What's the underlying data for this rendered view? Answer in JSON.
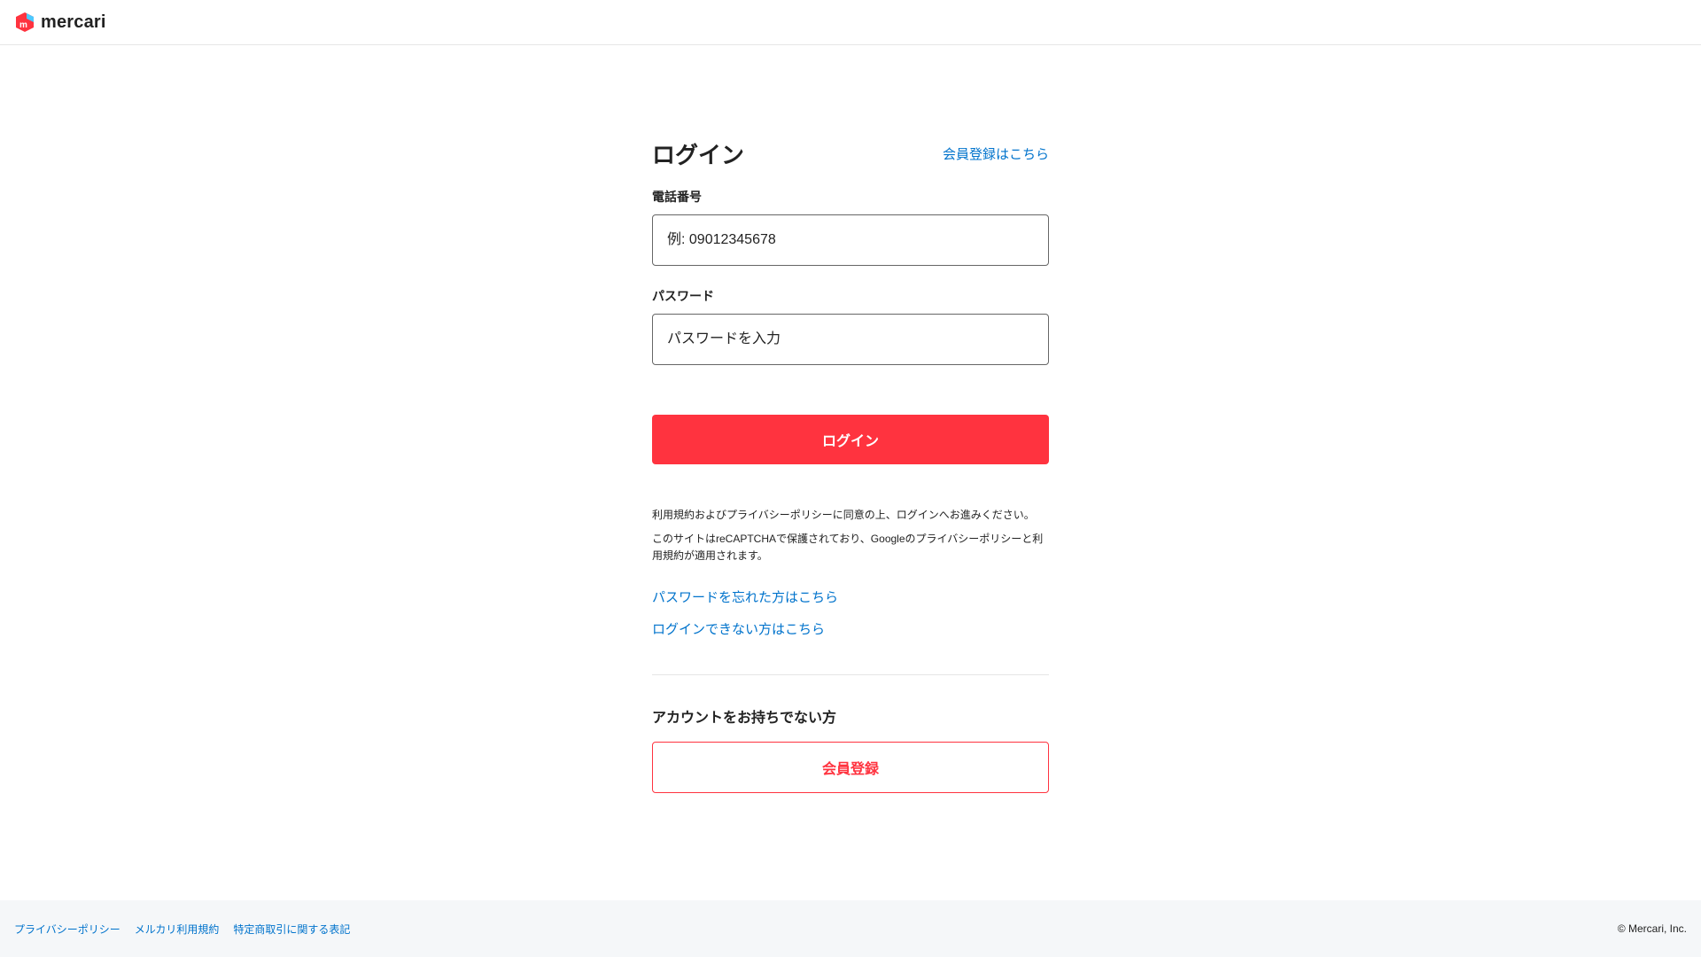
{
  "header": {
    "brand": "mercari",
    "logo_colors": {
      "red": "#ff333f",
      "blue": "#4dc9ff"
    }
  },
  "login": {
    "title": "ログイン",
    "register_link": "会員登録はこちら",
    "phone_label": "電話番号",
    "phone_placeholder": "例: 09012345678",
    "phone_value": "",
    "password_label": "パスワード",
    "password_placeholder": "パスワードを入力",
    "password_value": "",
    "submit_label": "ログイン",
    "terms_notice": "利用規約およびプライバシーポリシーに同意の上、ログインへお進みください。",
    "recaptcha_notice": "このサイトはreCAPTCHAで保護されており、Googleのプライバシーポリシーと利用規約が適用されます。",
    "forgot_password_link": "パスワードを忘れた方はこちら",
    "cannot_login_link": "ログインできない方はこちら"
  },
  "signup": {
    "heading": "アカウントをお持ちでない方",
    "button_label": "会員登録"
  },
  "footer": {
    "links": [
      "プライバシーポリシー",
      "メルカリ利用規約",
      "特定商取引に関する表記"
    ],
    "copyright": "© Mercari, Inc."
  },
  "colors": {
    "accent": "#ff333f",
    "link": "#0073cc",
    "footer_bg": "#f5f7f9"
  }
}
